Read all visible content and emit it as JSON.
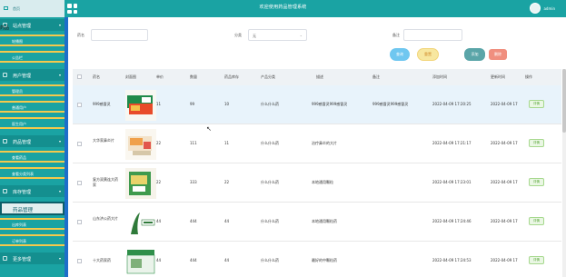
{
  "app": {
    "title": "欢迎使用药品管理系统",
    "user_name": "admin"
  },
  "sidebar": {
    "home": "首页",
    "edge_text": "药品",
    "groups": [
      {
        "label": "站点管理",
        "items": [
          "轮播图",
          "公告栏"
        ]
      },
      {
        "label": "用户管理",
        "items": [
          "管理员",
          "普通用户",
          "医生用户"
        ]
      },
      {
        "label": "药品管理",
        "items": [
          "查看药品",
          "查看分类列表"
        ]
      },
      {
        "label": "库存管理",
        "items": [
          "药品管理",
          "出库列表",
          "订单列表"
        ]
      },
      {
        "label": "更多管理",
        "items": []
      }
    ],
    "active_item": "药品管理"
  },
  "filters": {
    "name_label": "药名",
    "category_label": "分类",
    "category_value": "无",
    "remark_label": "备注"
  },
  "buttons": {
    "search": "查询",
    "reset": "重置",
    "add": "添加",
    "delete": "删除"
  },
  "table": {
    "headers": [
      "药名",
      "封面图",
      "单价",
      "数量",
      "药品库存",
      "产品分类",
      "描述",
      "备注",
      "添加时间",
      "更新时间",
      "操作"
    ],
    "detail_label": "详情",
    "rows": [
      {
        "name": "999感冒灵",
        "price": "11",
        "quantity": "99",
        "stock": "10",
        "category": "什么什么药",
        "description": "999感冒灵999感冒灵",
        "remark": "999感冒灵999感冒灵",
        "created": "2022-04-09 17:20:25",
        "updated": "2022-04-09 17"
      },
      {
        "name": "大华家鼻炎片",
        "price": "22",
        "quantity": "111",
        "stock": "11",
        "category": "什么什么药",
        "description": "治疗鼻炎的大片",
        "remark": "",
        "created": "2022-04-09 17:21:17",
        "updated": "2022-04-09 17"
      },
      {
        "name": "复方双黄连大药家",
        "price": "22",
        "quantity": "333",
        "stock": "22",
        "category": "什么什么药",
        "description": "本地通用颗粒",
        "remark": "",
        "created": "2022-04-09 17:23:01",
        "updated": "2022-04-09 17"
      },
      {
        "name": "山东济公药大片",
        "price": "44",
        "quantity": "444",
        "stock": "44",
        "category": "什么什么药",
        "description": "本地通用颗粒药",
        "remark": "",
        "created": "2022-04-09 17:24:46",
        "updated": "2022-04-09 17"
      },
      {
        "name": "十大药家药",
        "price": "44",
        "quantity": "444",
        "stock": "44",
        "category": "什么什么药",
        "description": "最好的中颗粒药",
        "remark": "",
        "created": "2022-04-09 17:24:53",
        "updated": "2022-04-09 17"
      }
    ]
  }
}
